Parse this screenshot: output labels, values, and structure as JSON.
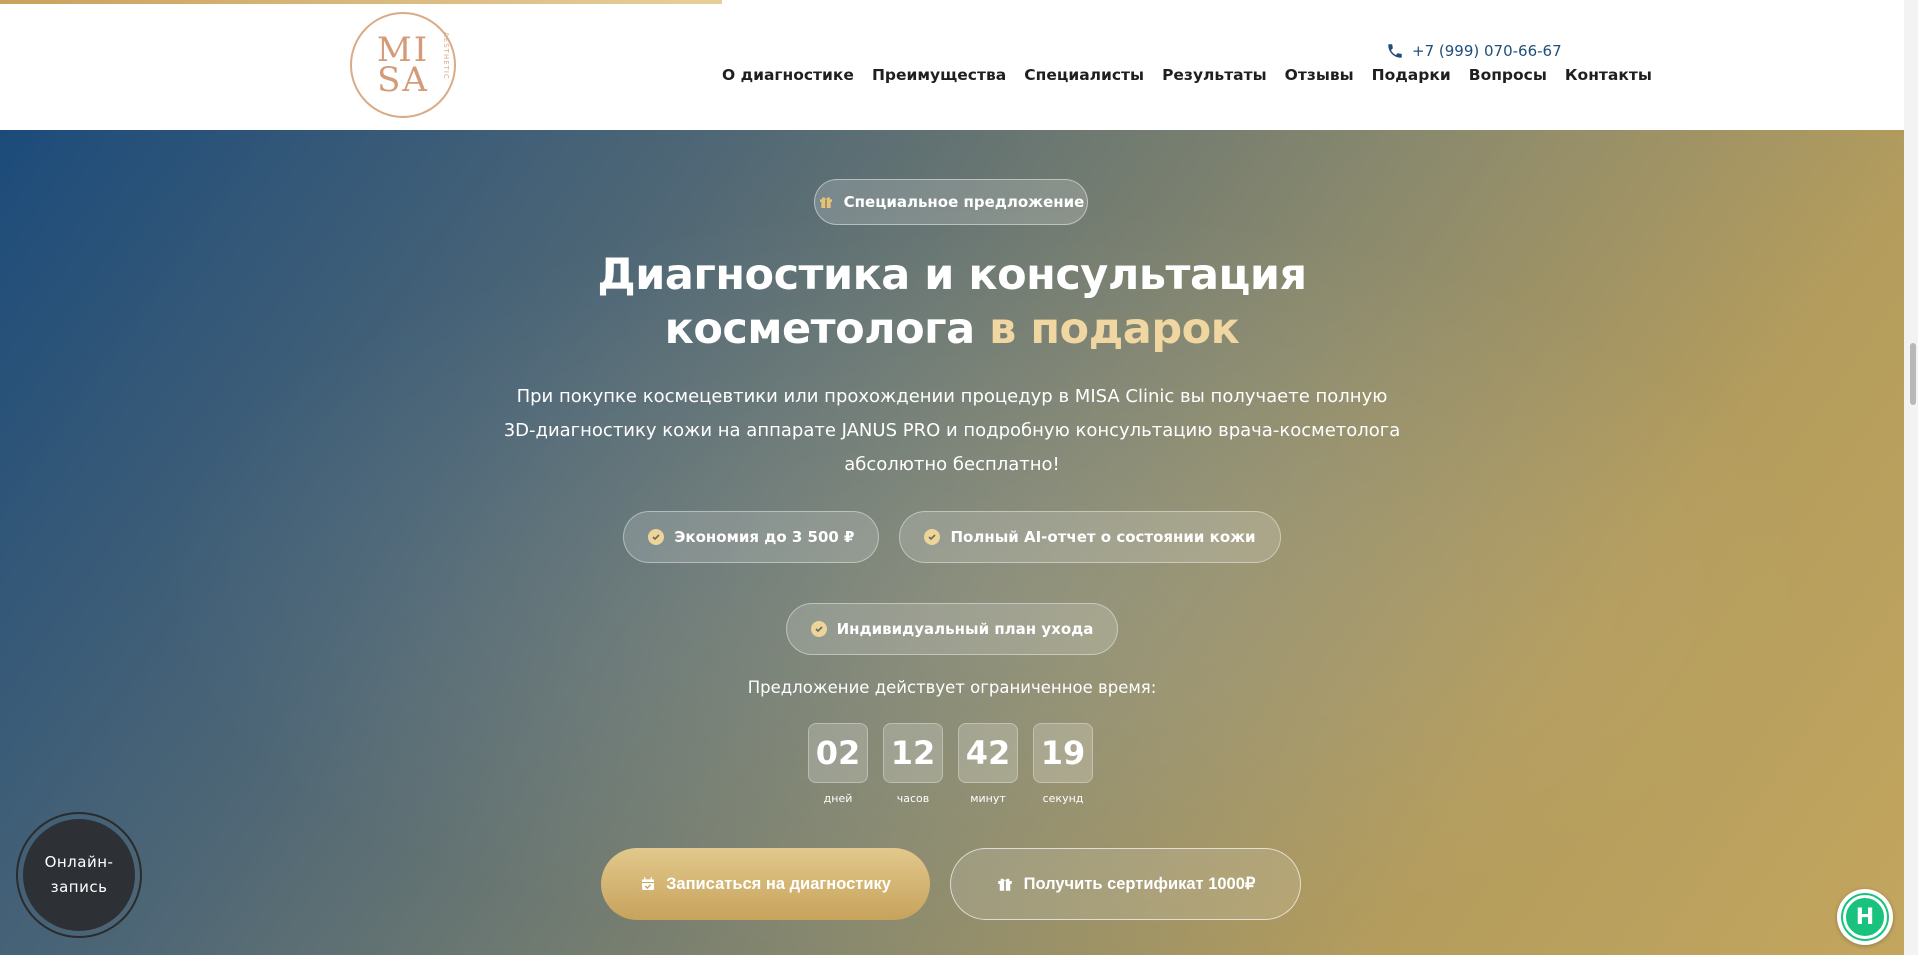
{
  "header": {
    "logo": {
      "top": "MI",
      "bottom": "SA",
      "ring_text": "AESTHETIC"
    },
    "phone": "+7 (999) 070-66-67",
    "nav": [
      "О диагностике",
      "Преимущества",
      "Специалисты",
      "Результаты",
      "Отзывы",
      "Подарки",
      "Вопросы",
      "Контакты"
    ]
  },
  "hero": {
    "badge": "Специальное предложение",
    "title_main": "Диагностика и консультация косметолога ",
    "title_accent": "в подарок",
    "subtitle": "При покупке космецевтики или прохождении процедур в MISA Clinic вы получаете полную 3D-диагностику кожи на аппарате JANUS PRO и подробную консультацию врача-косметолога абсолютно бесплатно!",
    "chips": [
      "Экономия до 3 500 ₽",
      "Полный AI-отчет о состоянии кожи",
      "Индивидуальный план ухода"
    ],
    "offer_text": "Предложение действует ограниченное время:",
    "timer": {
      "days": "02",
      "days_label": "дней",
      "hours": "12",
      "hours_label": "часов",
      "minutes": "42",
      "minutes_label": "минут",
      "seconds": "19",
      "seconds_label": "секунд"
    },
    "cta_primary": "Записаться на диагностику",
    "cta_secondary": "Получить сертификат 1000₽"
  },
  "floating": {
    "online_booking": "Онлайн-запись",
    "widget_letter": "H"
  },
  "colors": {
    "accent_gold": "#c9a15c",
    "accent_text": "#f0d6a0",
    "phone": "#1f4e7a",
    "hero_start": "#1c4b7a",
    "hero_end": "#c3a65e",
    "widget_green": "#19c37d"
  },
  "icons": {
    "phone": "phone-icon",
    "badge": "gift-icon",
    "chip": "check-circle-icon",
    "cta_primary": "calendar-check-icon",
    "cta_secondary": "gift-icon"
  }
}
